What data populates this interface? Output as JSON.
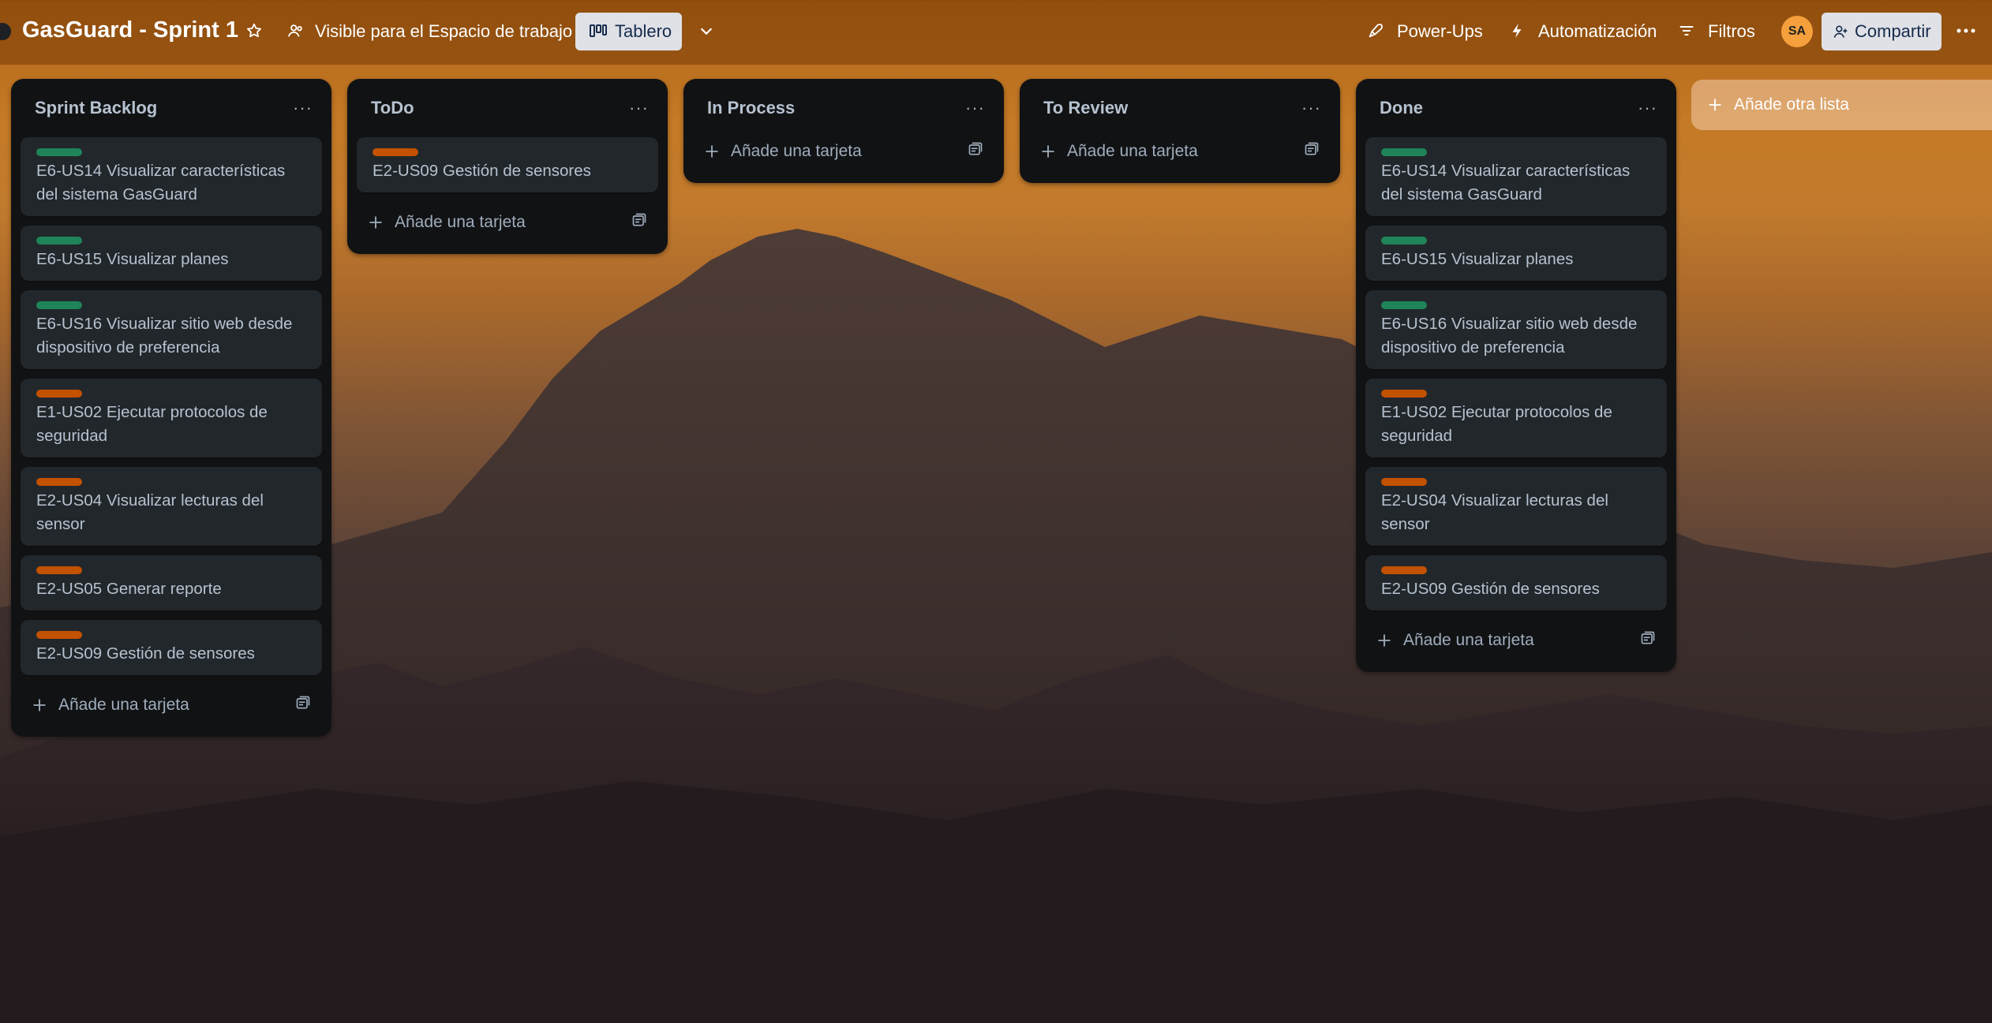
{
  "header": {
    "board_title": "GasGuard - Sprint 1",
    "visibility": "Visible para el Espacio de trabajo",
    "view_label": "Tablero",
    "powerups": "Power-Ups",
    "automation": "Automatización",
    "filters": "Filtros",
    "avatar_initials": "SA",
    "share": "Compartir"
  },
  "lists": [
    {
      "title": "Sprint Backlog",
      "cards": [
        {
          "label": "green",
          "text": "E6-US14 Visualizar características del sistema GasGuard"
        },
        {
          "label": "green",
          "text": "E6-US15 Visualizar planes"
        },
        {
          "label": "green",
          "text": "E6-US16 Visualizar sitio web desde dispositivo de preferencia"
        },
        {
          "label": "orange",
          "text": "E1-US02 Ejecutar protocolos de seguridad"
        },
        {
          "label": "orange",
          "text": "E2-US04 Visualizar lecturas del sensor"
        },
        {
          "label": "orange",
          "text": "E2-US05 Generar reporte"
        },
        {
          "label": "orange",
          "text": "E2-US09 Gestión de sensores"
        }
      ]
    },
    {
      "title": "ToDo",
      "cards": [
        {
          "label": "orange",
          "text": "E2-US09 Gestión de sensores"
        }
      ]
    },
    {
      "title": "In Process",
      "cards": []
    },
    {
      "title": "To Review",
      "cards": []
    },
    {
      "title": "Done",
      "cards": [
        {
          "label": "green",
          "text": "E6-US14 Visualizar características del sistema GasGuard"
        },
        {
          "label": "green",
          "text": "E6-US15 Visualizar planes"
        },
        {
          "label": "green",
          "text": "E6-US16 Visualizar sitio web desde dispositivo de preferencia"
        },
        {
          "label": "orange",
          "text": "E1-US02 Ejecutar protocolos de seguridad"
        },
        {
          "label": "orange",
          "text": "E2-US04 Visualizar lecturas del sensor"
        },
        {
          "label": "orange",
          "text": "E2-US09 Gestión de sensores"
        }
      ]
    }
  ],
  "add_card_label": "Añade una tarjeta",
  "list_menu": "···",
  "add_list_label": "Añade otra lista",
  "colors": {
    "label_green": "#1f845a",
    "label_orange": "#c25100",
    "list_bg": "#111214",
    "card_bg": "#22272b"
  }
}
